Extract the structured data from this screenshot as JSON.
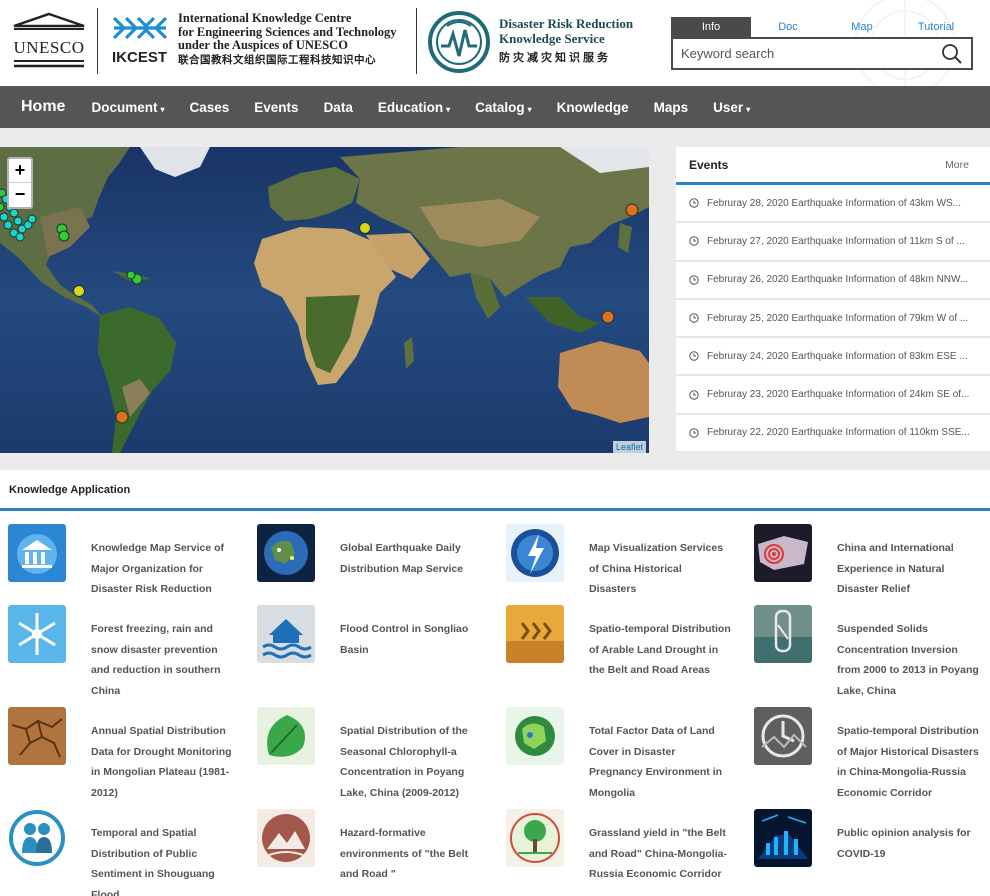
{
  "header": {
    "ikcest_lines": [
      "International Knowledge Centre",
      "for Engineering Sciences and Technology",
      "under the Auspices of UNESCO"
    ],
    "ikcest_cn": "联合国教科文组织国际工程科技知识中心",
    "ikcest_logo_text": "IKCEST",
    "unesco_logo_text": "UNESCO",
    "drr_lines": [
      "Disaster Risk Reduction",
      "Knowledge Service"
    ],
    "drr_cn": "防灾减灾知识服务"
  },
  "search": {
    "tabs": [
      "Info",
      "Doc",
      "Map",
      "Tutorial"
    ],
    "active_tab": "Info",
    "placeholder": "Keyword search"
  },
  "nav": {
    "items": [
      {
        "label": "Home"
      },
      {
        "label": "Document",
        "dropdown": true
      },
      {
        "label": "Cases"
      },
      {
        "label": "Events"
      },
      {
        "label": "Data"
      },
      {
        "label": "Education",
        "dropdown": true
      },
      {
        "label": "Catalog",
        "dropdown": true
      },
      {
        "label": "Knowledge"
      },
      {
        "label": "Maps"
      },
      {
        "label": "User",
        "dropdown": true
      }
    ]
  },
  "map": {
    "zoom_in": "+",
    "zoom_out": "−",
    "attribution": "Leaflet"
  },
  "events": {
    "title": "Events",
    "more": "More",
    "items": [
      "Februray 28, 2020 Earthquake Information of 43km WS...",
      "Februray 27, 2020 Earthquake Information of 11km S of ...",
      "Februray 26, 2020 Earthquake Information of 48km NNW...",
      "Februray 25, 2020 Earthquake Information of 79km W of ...",
      "Februray 24, 2020 Earthquake Information of 83km ESE ...",
      "Februray 23, 2020 Earthquake Information of 24km SE of...",
      "Februray 22, 2020 Earthquake Information of 110km SSE..."
    ]
  },
  "knowledge": {
    "title": "Knowledge Application",
    "items": [
      {
        "title": "Knowledge Map Service of Major Organization for Disaster Risk Reduction",
        "icon": "institution-icon"
      },
      {
        "title": "Global Earthquake Daily Distribution Map Service",
        "icon": "globe-icon"
      },
      {
        "title": "Map Visualization Services of China Historical Disasters",
        "icon": "lightning-globe-icon"
      },
      {
        "title": "China and International Experience in Natural Disaster Relief",
        "icon": "target-map-icon"
      },
      {
        "title": "Forest freezing, rain and snow disaster prevention and reduction in southern China",
        "icon": "snowflake-icon"
      },
      {
        "title": "Flood Control in Songliao Basin",
        "icon": "flood-house-icon"
      },
      {
        "title": "Spatio-temporal Distribution of Arable Land Drought in the Belt and Road Areas",
        "icon": "drought-icon"
      },
      {
        "title": "Suspended Solids Concentration Inversion from 2000 to 2013 in Poyang Lake, China",
        "icon": "water-sample-icon"
      },
      {
        "title": "Annual Spatial Distribution Data for Drought Monitoring in Mongolian Plateau (1981-2012)",
        "icon": "cracked-earth-icon"
      },
      {
        "title": "Spatial Distribution of the Seasonal Chlorophyll-a Concentration in Poyang Lake, China (2009-2012)",
        "icon": "leaf-icon"
      },
      {
        "title": "Total Factor Data of Land Cover in Disaster Pregnancy Environment in Mongolia",
        "icon": "green-globe-icon"
      },
      {
        "title": "Spatio-temporal Distribution of Major Historical Disasters in China-Mongolia-Russia Economic Corridor",
        "icon": "disaster-history-icon"
      },
      {
        "title": "Temporal and Spatial Distribution of Public Sentiment in Shouguang Flood",
        "icon": "people-circle-icon"
      },
      {
        "title": "Hazard-formative environments of \"the Belt and Road \"",
        "icon": "mountain-circle-icon"
      },
      {
        "title": "Grassland yield in \"the Belt and Road\" China-Mongolia-Russia Economic Corridor",
        "icon": "tree-circle-icon"
      },
      {
        "title": "Public opinion analysis for COVID-19",
        "icon": "data-tunnel-icon"
      }
    ]
  },
  "colors": {
    "accent": "#2a82c8",
    "nav_bg": "#555555",
    "marker_cyan": "#19d6c8",
    "marker_green": "#33cc33",
    "marker_yellow": "#d8d81a",
    "marker_orange": "#e0701c"
  }
}
